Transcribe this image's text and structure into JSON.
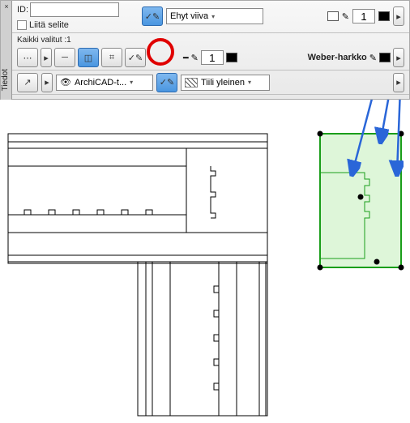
{
  "panel": {
    "tab_label": "Tiedot",
    "close_glyph": "×"
  },
  "row1": {
    "id_label": "ID:",
    "id_value": "",
    "attach_legend_label": "Liitä selite",
    "linetype_label": "Ehyt viiva",
    "pen1_value": "1"
  },
  "row2": {
    "selected_label": "Kaikki valitut :1",
    "pen2_value": "1",
    "section_label": "Weber-harkko"
  },
  "row3": {
    "layer_label": "ArchiCAD-t...",
    "fill_label": "Tiili yleinen"
  },
  "icons": {
    "check_pen": "✓✎",
    "dropdown_arrow": "▾",
    "flyout": "▸",
    "eye": "👁",
    "pencil": "✎",
    "chair": "⌗",
    "eraser": "◫",
    "line_solid": "━",
    "line_none": "─",
    "dotted": "⋯"
  }
}
